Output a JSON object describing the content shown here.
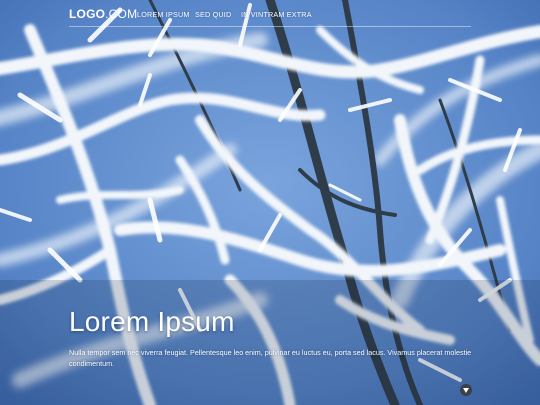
{
  "header": {
    "logo_bold": "LOGO",
    "logo_light": ".COM",
    "nav": [
      {
        "label": "LOREM IPSUM"
      },
      {
        "label": "SED QUID"
      },
      {
        "label": "IN VINTRAM EXTRA"
      }
    ]
  },
  "hero": {
    "title": "Lorem Ipsum",
    "body": "Nulla tempor sem nec viverra feugiat. Pellentesque leo enim, pulvinar eu luctus eu, porta sed lacus. Vivamus placerat molestie condimentum."
  },
  "icons": {
    "scroll": "chevron-down-icon"
  },
  "colors": {
    "sky": "#5f8ccd",
    "frost": "#f2f6fb",
    "branch": "#2f3c4a",
    "button": "#3a3f48"
  }
}
